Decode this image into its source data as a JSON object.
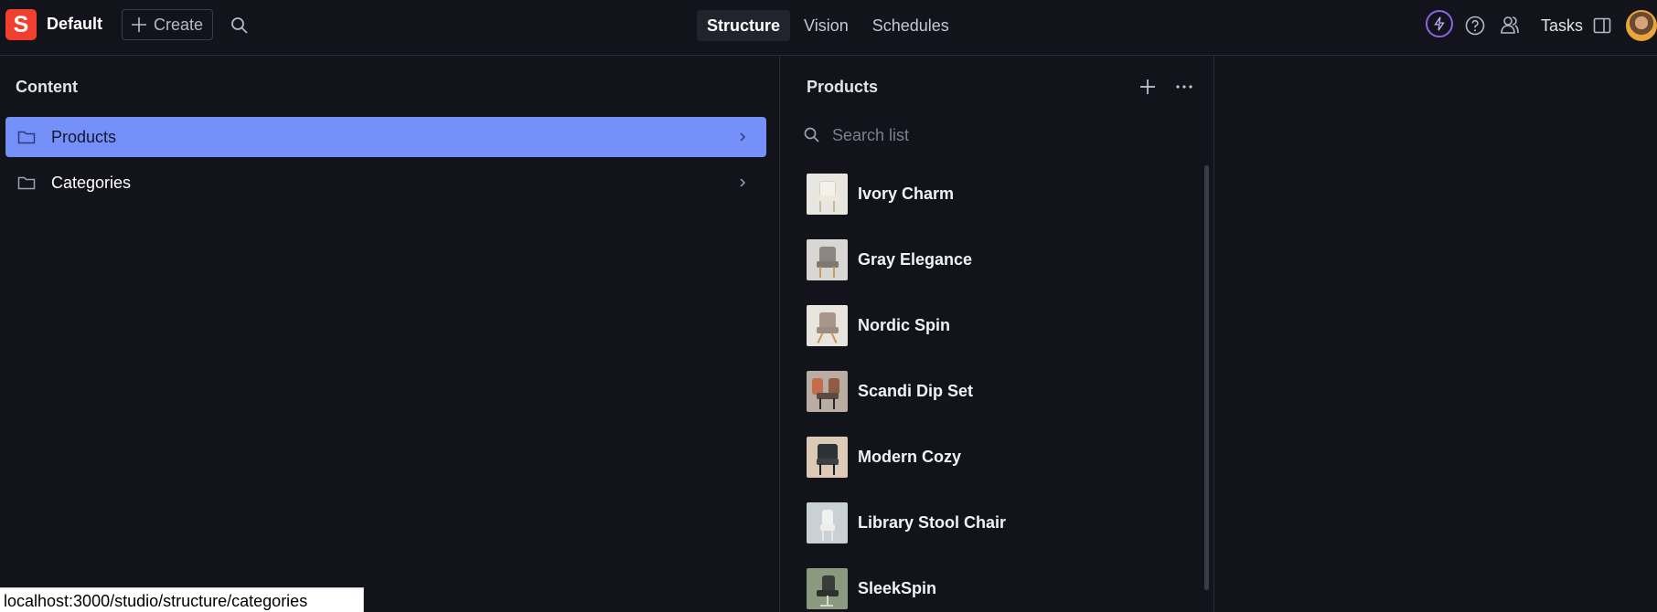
{
  "topbar": {
    "logo_letter": "S",
    "workspace": "Default",
    "create_label": "Create",
    "tabs": [
      {
        "label": "Structure",
        "active": true
      },
      {
        "label": "Vision",
        "active": false
      },
      {
        "label": "Schedules",
        "active": false
      }
    ],
    "tasks_label": "Tasks",
    "icons": [
      "search-icon",
      "bolt-icon",
      "help-icon",
      "people-icon",
      "panel-toggle-icon"
    ]
  },
  "content": {
    "title": "Content",
    "items": [
      {
        "label": "Products",
        "selected": true,
        "icon": "folder-icon"
      },
      {
        "label": "Categories",
        "selected": false,
        "icon": "folder-icon"
      }
    ]
  },
  "products": {
    "title": "Products",
    "search_placeholder": "Search list",
    "items": [
      {
        "name": "Ivory Charm"
      },
      {
        "name": "Gray Elegance"
      },
      {
        "name": "Nordic Spin"
      },
      {
        "name": "Scandi Dip Set"
      },
      {
        "name": "Modern Cozy"
      },
      {
        "name": "Library Stool Chair"
      },
      {
        "name": "SleekSpin"
      }
    ]
  },
  "status_url": "localhost:3000/studio/structure/categories",
  "colors": {
    "background": "#13141b",
    "selected": "#7590f9",
    "brand": "#f03e2f",
    "accent": "#8a64e8"
  }
}
